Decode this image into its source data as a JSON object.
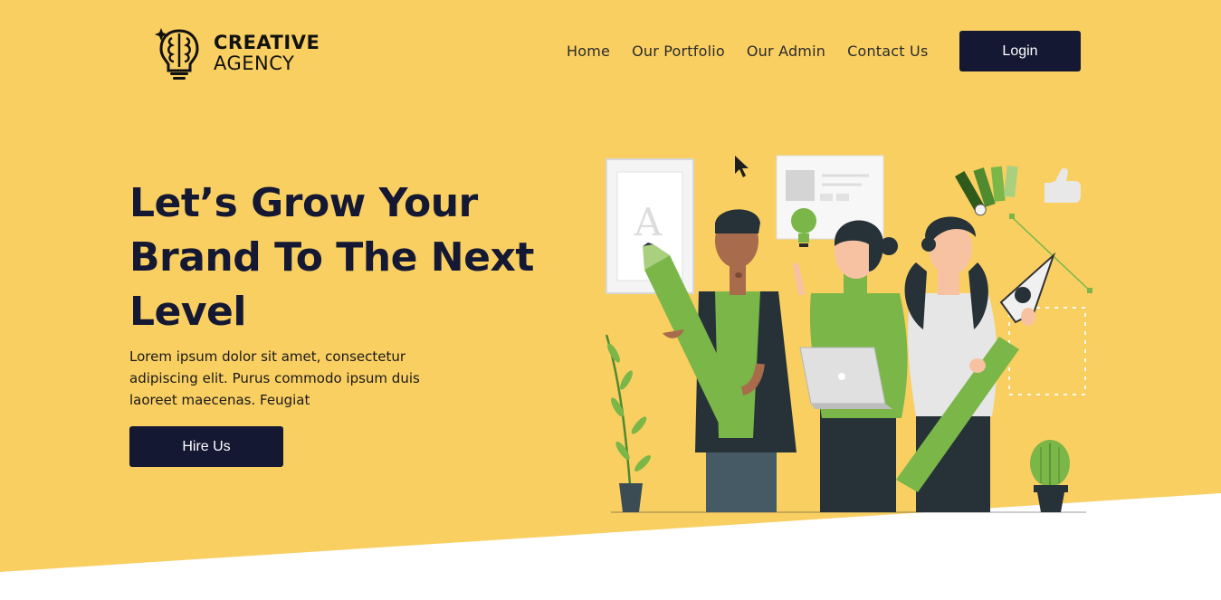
{
  "colors": {
    "background_yellow": "#F9CF62",
    "navy": "#141833",
    "green": "#7AB648",
    "white": "#FFFFFF"
  },
  "brand": {
    "line1": "CREATIVE",
    "line2": "AGENCY",
    "icon": "brain-lightbulb-icon"
  },
  "nav": {
    "items": [
      "Home",
      "Our Portfolio",
      "Our Admin",
      "Contact Us"
    ],
    "login_label": "Login"
  },
  "hero": {
    "headline_line1": "Let’s Grow Your",
    "headline_line2": "Brand To The Next",
    "headline_line3": "Level",
    "sub_line1": "Lorem ipsum dolor sit amet, consectetur",
    "sub_line2": "adipiscing elit. Purus commodo ipsum duis",
    "sub_line3": "laoreet maecenas. Feugiat",
    "cta_label": "Hire Us"
  },
  "illustration": {
    "poster_letter": "A",
    "icons": [
      "pencil-icon",
      "pen-tool-icon",
      "color-swatch-icon",
      "thumbs-up-icon",
      "lightbulb-icon",
      "cursor-icon",
      "plant-icon",
      "cactus-icon",
      "laptop-icon"
    ]
  }
}
